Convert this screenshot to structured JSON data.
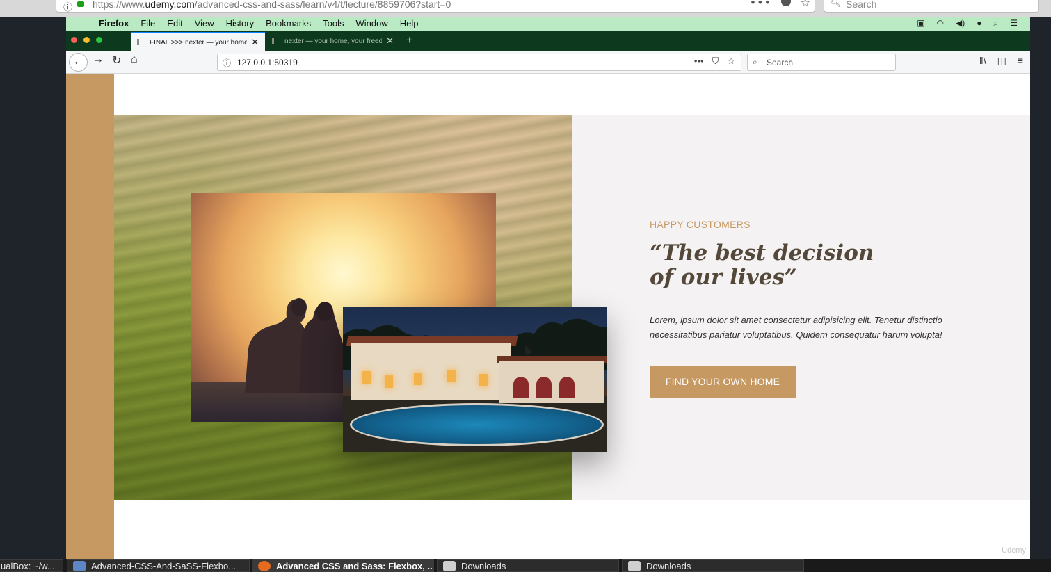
{
  "host_browser": {
    "url_prefix": "https://www.",
    "url_domain": "udemy.com",
    "url_path": "/advanced-css-and-sass/learn/v4/t/lecture/8859706?start=0",
    "search_placeholder": "Search"
  },
  "menubar": {
    "items": [
      "Firefox",
      "File",
      "Edit",
      "View",
      "History",
      "Bookmarks",
      "Tools",
      "Window",
      "Help"
    ]
  },
  "tabs": [
    {
      "title": "FINAL >>> nexter — your home",
      "active": true
    },
    {
      "title": "nexter — your home, your freedom",
      "active": false
    }
  ],
  "navbar": {
    "url": "127.0.0.1:50319",
    "search_placeholder": "Search"
  },
  "story": {
    "kicker": "HAPPY CUSTOMERS",
    "quote_line1": "“The best decision",
    "quote_line2": "of our lives”",
    "body": "Lorem, ipsum dolor sit amet consectetur adipisicing elit. Tenetur distinctio necessitatibus pariatur voluptatibus. Quidem consequatur harum volupta!",
    "button_label": "FIND YOUR OWN HOME"
  },
  "watermark": "Udemy",
  "taskbar": {
    "items": [
      {
        "label": "ualBox: ~/w...",
        "active": false
      },
      {
        "label": "Advanced-CSS-And-SaSS-Flexbo...",
        "active": false
      },
      {
        "label": "Advanced CSS and Sass: Flexbox, ...",
        "active": true
      },
      {
        "label": "Downloads",
        "active": false
      },
      {
        "label": "Downloads",
        "active": false
      }
    ]
  },
  "colors": {
    "accent": "#c69963",
    "menubar": "#b9eac4",
    "tabstrip": "#0d3a1e"
  }
}
